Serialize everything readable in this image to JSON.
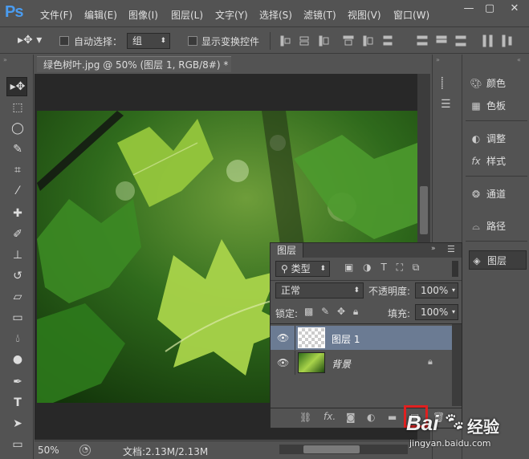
{
  "app": {
    "logo": "Ps"
  },
  "menu": [
    "文件(F)",
    "编辑(E)",
    "图像(I)",
    "图层(L)",
    "文字(Y)",
    "选择(S)",
    "滤镜(T)",
    "视图(V)",
    "窗口(W)"
  ],
  "window_controls": {
    "minimize": "—",
    "restore": "▢",
    "close": "✕"
  },
  "options": {
    "auto_select_label": "自动选择：",
    "auto_select_value": "组",
    "show_transform_label": "显示变换控件"
  },
  "document": {
    "tab_title": "绿色树叶.jpg @ 50% (图层 1, RGB/8#) *",
    "tab_close": "×",
    "zoom": "50%",
    "doc_size": "文档:2.13M/2.13M"
  },
  "right_panel": {
    "items": [
      "颜色",
      "色板",
      "调整",
      "样式",
      "通道",
      "路径",
      "图层"
    ],
    "icons": [
      "palette-icon",
      "grid-icon",
      "adjust-icon",
      "fx-icon",
      "channels-icon",
      "paths-icon",
      "layers-icon"
    ]
  },
  "layers_panel": {
    "title": "图层",
    "filter_label": "类型",
    "blend_mode": "正常",
    "opacity_label": "不透明度:",
    "opacity_value": "100%",
    "lock_label": "锁定:",
    "fill_label": "填充:",
    "fill_value": "100%",
    "layers": [
      {
        "name": "图层 1",
        "selected": true
      },
      {
        "name": "背景",
        "selected": false,
        "locked": true
      }
    ],
    "footer_icons": [
      "link-icon",
      "fx-icon",
      "mask-icon",
      "adjustment-icon",
      "folder-icon",
      "new-layer-icon",
      "trash-icon"
    ],
    "highlight_color": "#e02020"
  },
  "watermark": {
    "brand": "Bai",
    "brand2": "经验",
    "url": "jingyan.baidu.com"
  },
  "colors": {
    "ui_bg": "#535353",
    "canvas_bg": "#282828",
    "selected_layer": "#6b7b93",
    "logo": "#4a9cf0"
  }
}
